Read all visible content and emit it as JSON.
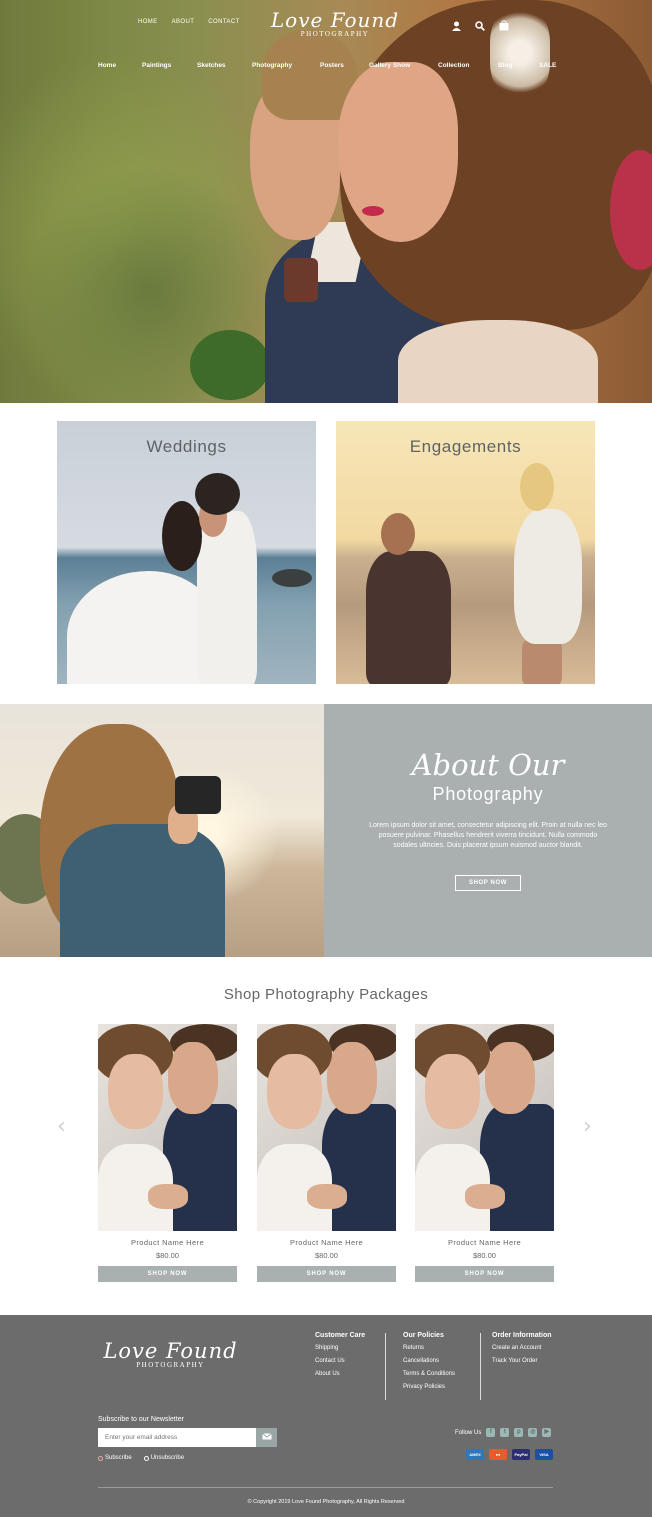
{
  "header": {
    "top_links": [
      "HOME",
      "ABOUT",
      "CONTACT"
    ],
    "logo_script": "Love Found",
    "logo_sub": "PHOTOGRAPHY",
    "icons": [
      "user-icon",
      "search-icon",
      "bag-icon"
    ],
    "nav": [
      "Home",
      "Paintings",
      "Sketches",
      "Photography",
      "Posters",
      "Gallery Show",
      "Collection",
      "Blog",
      "SALE"
    ]
  },
  "categories": [
    {
      "title": "Weddings"
    },
    {
      "title": "Engagements"
    }
  ],
  "about": {
    "script": "About Our",
    "title": "Photography",
    "text": "Lorem ipsum dolor sit amet, consectetur adipiscing elit. Proin at nulla nec leo posuere pulvinar. Phasellus hendrerit viverra tincidunt. Nulla commodo sodales ultricies. Duis placerat ipsum euismod auctor blandit.",
    "button": "SHOP NOW"
  },
  "shop": {
    "title": "Shop Photography Packages",
    "products": [
      {
        "name": "Product Name Here",
        "price": "$80.00",
        "button": "SHOP NOW"
      },
      {
        "name": "Product Name Here",
        "price": "$80.00",
        "button": "SHOP NOW"
      },
      {
        "name": "Product Name Here",
        "price": "$80.00",
        "button": "SHOP NOW"
      }
    ],
    "prev_arrow": "‹",
    "next_arrow": "›"
  },
  "footer": {
    "logo_script": "Love Found",
    "logo_sub": "PHOTOGRAPHY",
    "customer_care": {
      "title": "Customer Care",
      "links": [
        "Shipping",
        "Contact Us",
        "About Us"
      ]
    },
    "policies": {
      "title": "Our Policies",
      "links": [
        "Returns",
        "Cancellations",
        "Terms & Conditions",
        "Privacy Policies"
      ]
    },
    "order_info": {
      "title": "Order Information",
      "links": [
        "Create an Account",
        "Track Your Order"
      ]
    },
    "newsletter_label": "Subscribe to our Newsletter",
    "email_placeholder": "Enter your email address",
    "subscribe": "Subscribe",
    "unsubscribe": "Unsubscribe",
    "follow_label": "Follow Us",
    "social_icons": [
      "facebook-icon",
      "twitter-icon",
      "pinterest-icon",
      "instagram-icon",
      "youtube-icon"
    ],
    "payments": [
      "amex",
      "mastercard",
      "paypal",
      "visa"
    ],
    "copyright": "© Copyright 2019 Love Found Photography, All Rights Reserved"
  },
  "colors": {
    "panel_gray": "#a9b0af",
    "footer_gray": "#6c6c6c",
    "accent_teal": "#9ab8b6"
  }
}
